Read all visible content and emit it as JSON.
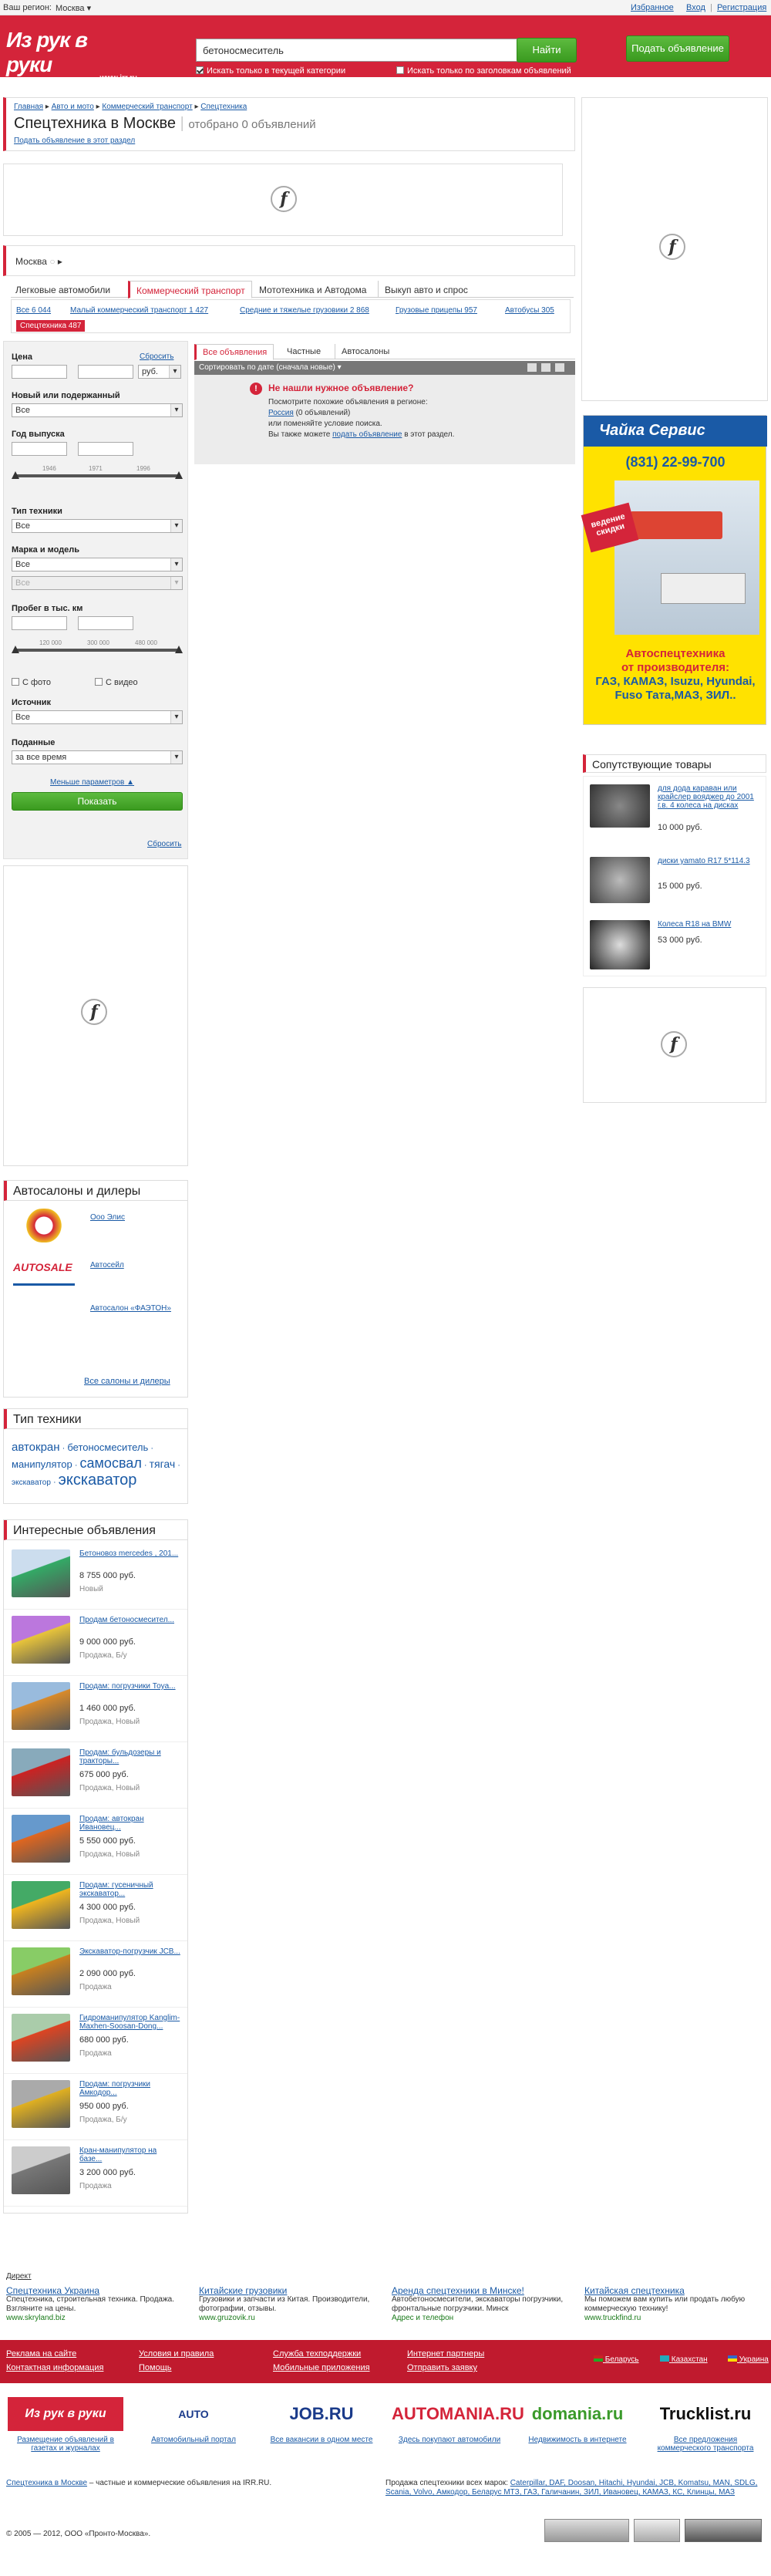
{
  "topbar": {
    "region_label": "Ваш регион:",
    "region": "Москва",
    "favorites": "Избранное",
    "login": "Вход",
    "register": "Регистрация"
  },
  "header": {
    "logo_text": "Из рук в руки",
    "logo_domain": "www.irr.ru",
    "search_value": "бетоносмеситель",
    "find_button": "Найти",
    "post_button": "Подать объявление",
    "opt_category": "Искать только в текущей категории",
    "opt_titles": "Искать только по заголовкам объявлений"
  },
  "breadcrumb": [
    "Главная",
    "Авто и мото",
    "Коммерческий транспорт",
    "Спецтехника"
  ],
  "page": {
    "title": "Спецтехника в Москве",
    "found": "отобрано 0 объявлений",
    "post_link": "Подать объявление в этот раздел"
  },
  "location": {
    "city": "Москва"
  },
  "cat_tabs": [
    "Легковые автомобили",
    "Коммерческий транспорт",
    "Мототехника и Автодома",
    "Выкуп авто и спрос"
  ],
  "subcats": [
    "Все 6 044",
    "Малый коммерческий транспорт 1 427",
    "Средние и тяжелые грузовики 2 868",
    "Грузовые прицепы 957",
    "Автобусы 305",
    "Спецтехника 487"
  ],
  "filters": {
    "price": "Цена",
    "reset": "Сбросить",
    "currency": "руб.",
    "condition": "Новый или подержанный",
    "condition_val": "Все",
    "year": "Год выпуска",
    "year_ticks": [
      "1946",
      "1971",
      "1996"
    ],
    "type": "Тип техники",
    "type_val": "Все",
    "make": "Марка и модель",
    "make_val": "Все",
    "model_val": "Все",
    "mileage": "Пробег в тыс. км",
    "mileage_ticks": [
      "120 000",
      "300 000",
      "480 000"
    ],
    "with_photo": "С фото",
    "with_video": "С видео",
    "source": "Источник",
    "source_val": "Все",
    "posted": "Поданные",
    "posted_val": "за все время",
    "less": "Меньше параметров",
    "show": "Показать",
    "reset2": "Сбросить"
  },
  "results": {
    "tabs": [
      "Все объявления",
      "Частные",
      "Автосалоны"
    ],
    "sort": "Сортировать по дате (сначала новые)",
    "empty_title": "Не нашли нужное объявление?",
    "empty_l1": "Посмотрите похожие объявления в регионе:",
    "empty_region": "Россия",
    "empty_region_count": "(0 объявлений)",
    "empty_l2": "или поменяйте условие поиска.",
    "empty_l3": "Вы также можете",
    "empty_link": "подать объявление",
    "empty_l3b": "в этот раздел."
  },
  "banner": {
    "brand": "Чайка Сервис",
    "phone": "(831) 22-99-700",
    "sticker": "ведение скидки",
    "text1": "Автоспецтехника",
    "text2": "от производителя:",
    "text3": "ГАЗ, КАМАЗ, Isuzu, Hyundai,",
    "text4": "Fuso Тата,МАЗ, ЗИЛ.."
  },
  "related": {
    "title": "Сопутствующие товары",
    "items": [
      {
        "name": "для дода караван или крайслер вояджер до 2001 г.в. 4 колеса на дисках",
        "price": "10 000 руб."
      },
      {
        "name": "диски yamato R17 5*114.3",
        "price": "15 000 руб."
      },
      {
        "name": "Колеса R18 на BMW",
        "price": "53 000 руб."
      }
    ]
  },
  "dealers": {
    "title": "Автосалоны и дилеры",
    "items": [
      "Ооо Элис",
      "Автосейл",
      "Автосалон «ФАЭТОН»"
    ],
    "all": "Все салоны и дилеры"
  },
  "types": {
    "title": "Тип техники",
    "tags": [
      "автокран",
      "бетоносмеситель",
      "манипулятор",
      "самосвал",
      "тягач",
      "экскаватор",
      "экскаватор"
    ]
  },
  "interesting": {
    "title": "Интересные объявления",
    "items": [
      {
        "name": "Бетоновоз mercedes , 201...",
        "price": "8 755 000 руб.",
        "state": "Новый"
      },
      {
        "name": "Продам бетоносмесител...",
        "price": "9 000 000 руб.",
        "state": "Продажа, Б/у"
      },
      {
        "name": "Продам: погрузчики Тоyа...",
        "price": "1 460 000 руб.",
        "state": "Продажа, Новый"
      },
      {
        "name": "Продам: бульдозеры и тракторы...",
        "price": "675 000 руб.",
        "state": "Продажа, Новый"
      },
      {
        "name": "Продам: автокран Ивановец...",
        "price": "5 550 000 руб.",
        "state": "Продажа, Новый"
      },
      {
        "name": "Продам: гусеничный экскаватор...",
        "price": "4 300 000 руб.",
        "state": "Продажа, Новый"
      },
      {
        "name": "Экскаватор-погрузчик JCB...",
        "price": "2 090 000 руб.",
        "state": "Продажа"
      },
      {
        "name": "Гидроманипулятор Kanglim-Maxhen-Soosan-Dong...",
        "price": "680 000 руб.",
        "state": "Продажа"
      },
      {
        "name": "Продам: погрузчики Амкодор...",
        "price": "950 000 руб.",
        "state": "Продажа, Б/у"
      },
      {
        "name": "Кран-манипулятор на базе...",
        "price": "3 200 000 руб.",
        "state": "Продажа"
      }
    ]
  },
  "direct": {
    "label": "Директ",
    "ads": [
      {
        "title": "Спецтехника Украина",
        "text": "Спецтехника, строительная техника. Продажа. Взгляните на цены.",
        "url": "www.skryland.biz"
      },
      {
        "title": "Китайские грузовики",
        "text": "Грузовики и запчасти из Китая. Производители, фотографии, отзывы.",
        "url": "www.gruzovik.ru"
      },
      {
        "title": "Аренда спецтехники в Минске!",
        "text": "Автобетоносмесители, экскаваторы погрузчики, фронтальные погрузчики. Минск",
        "url": "Адрес и телефон"
      },
      {
        "title": "Китайская спецтехника",
        "text": "Мы поможем вам купить или продать любую коммерческую технику!",
        "url": "www.truckfind.ru"
      }
    ]
  },
  "footer": {
    "col1": [
      "Реклама на сайте",
      "Контактная информация"
    ],
    "col2": [
      "Условия и правила",
      "Помощь"
    ],
    "col3": [
      "Служба техподдержки",
      "Мобильные приложения"
    ],
    "col4": [
      "Интернет партнеры",
      "Отправить заявку"
    ],
    "countries": [
      "Беларусь",
      "Казахстан",
      "Украина"
    ],
    "partners": [
      {
        "name": "Из рук в руки",
        "caption": "Размещение объявлений в газетах и журналах"
      },
      {
        "name": "AUTO",
        "caption": "Автомобильный портал"
      },
      {
        "name": "JOB.RU",
        "caption": "Все вакансии в одном месте"
      },
      {
        "name": "AUTOMANIA.RU",
        "caption": "Здесь покупают автомобили"
      },
      {
        "name": "domania.ru",
        "caption": "Недвижимость в интернете"
      },
      {
        "name": "Trucklist.ru",
        "caption": "Все предложения коммерческого транспорта"
      }
    ],
    "bottom_link": "Спецтехника в Москве",
    "bottom_text": "– частные и коммерческие объявления на IRR.RU.",
    "brands_label": "Продажа спецтехники всех марок:",
    "brands": "Caterpillar, DAF, Doosan, Hitachi, Hyundai, JCB, Komatsu, MAN, SDLG, Scania, Volvo, Амкодор, Беларус МТЗ, ГАЗ, Галичанин, ЗИЛ, Ивановец, КАМАЗ, КС, Клинцы, МАЗ",
    "copyright": "© 2005 — 2012, ООО «Пронто-Москва»."
  }
}
